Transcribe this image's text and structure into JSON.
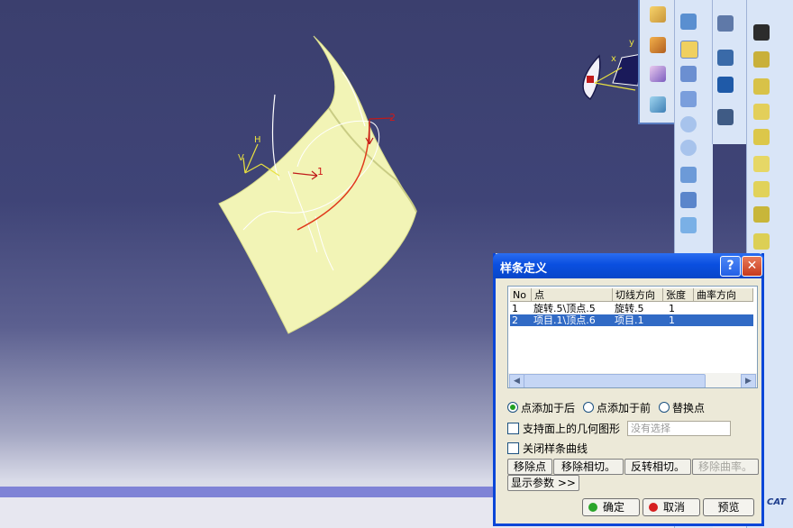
{
  "dialog": {
    "title": "样条定义",
    "help": "?",
    "close": "✕",
    "columns": [
      "No",
      "点",
      "切线方向",
      "张度",
      "曲率方向"
    ],
    "rows": [
      {
        "no": "1",
        "point": "旋转.5\\顶点.5",
        "tangent": "旋转.5",
        "tension": "1",
        "selected": false
      },
      {
        "no": "2",
        "point": "项目.1\\顶点.6",
        "tangent": "项目.1",
        "tension": "1",
        "selected": true
      }
    ],
    "radios": [
      {
        "label": "点添加于后",
        "checked": true
      },
      {
        "label": "点添加于前",
        "checked": false
      },
      {
        "label": "替换点",
        "checked": false
      }
    ],
    "geometry_on_support": "支持面上的几何图形",
    "no_selection": "没有选择",
    "close_spline": "关闭样条曲线",
    "buttons": {
      "remove_point": "移除点",
      "remove_tangent": "移除相切。",
      "reverse_tangent": "反转相切。",
      "remove_curvature": "移除曲率。",
      "show_params": "显示参数 >>"
    },
    "ok": "确定",
    "cancel": "取消",
    "preview": "预览"
  },
  "viewport": {
    "labels": {
      "pt1": "1",
      "pt2": "2",
      "axis_h": "H",
      "axis_v": "V",
      "axis_x": "x",
      "axis_y": "y"
    }
  },
  "brand": {
    "logo_text": "CAT"
  },
  "colors": {
    "surface": "#f2f4b6",
    "accent_red": "#e03a1c",
    "title_blue": "#0a4fe0",
    "selection": "#316ac5"
  }
}
